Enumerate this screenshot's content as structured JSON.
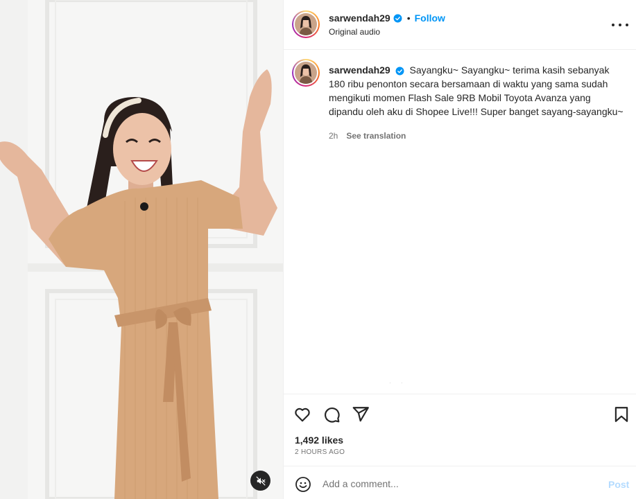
{
  "post": {
    "username": "sarwendah29",
    "follow_label": "Follow",
    "audio_label": "Original audio",
    "caption": "Sayangku~ Sayangku~ terima kasih sebanyak 180 ribu penonton secara bersamaan di waktu yang sama sudah mengikuti momen Flash Sale 9RB Mobil Toyota Avanza yang dipandu oleh aku di Shopee Live!!! Super banget sayang-sayangku~",
    "caption_age": "2h",
    "see_translation": "See translation",
    "likes": "1,492 likes",
    "time_ago": "2 HOURS AGO"
  },
  "comment_box": {
    "placeholder": "Add a comment...",
    "post_label": "Post"
  },
  "icons": {
    "verified": "verified-badge-icon",
    "more": "more-options-icon",
    "like": "heart-icon",
    "comment": "comment-icon",
    "share": "send-icon",
    "save": "bookmark-icon",
    "emoji": "emoji-icon",
    "mute": "muted-speaker-icon"
  },
  "colors": {
    "accent": "#0095f6",
    "verified": "#0095f6",
    "text": "#262626",
    "secondary": "#737373",
    "post_disabled": "#b3dbff"
  }
}
